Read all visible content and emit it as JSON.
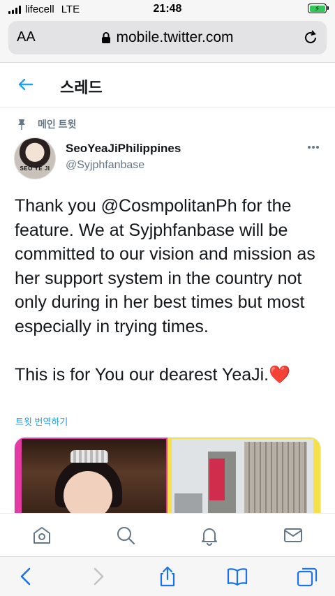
{
  "status_bar": {
    "carrier": "lifecell",
    "network": "LTE",
    "time": "21:48"
  },
  "browser": {
    "text_size_label": "AA",
    "url": "mobile.twitter.com"
  },
  "header": {
    "title": "스레드"
  },
  "tweet": {
    "pinned_label": "메인 트윗",
    "display_name": "SeoYeaJiPhilippines",
    "handle": "@Syjphfanbase",
    "avatar_text": "SEO YE JI",
    "text": "Thank you @CosmpolitanPh for the feature. We at Syjphfanbase will be committed  to our vision and mission as her support system in the country not only  during in her best times but most especially in trying times.\n\nThis is for You our dearest YeaJi.",
    "emoji": "❤️",
    "translate_label": "트윗 번역하기"
  },
  "colors": {
    "accent": "#1da1f2",
    "heart": "#e0245e",
    "secondary_text": "#657786"
  },
  "nav": {
    "icons": [
      "home-icon",
      "search-icon",
      "notifications-icon",
      "messages-icon"
    ]
  },
  "safari_toolbar": {
    "icons": [
      "back-icon",
      "forward-icon",
      "share-icon",
      "bookmarks-icon",
      "tabs-icon"
    ]
  }
}
